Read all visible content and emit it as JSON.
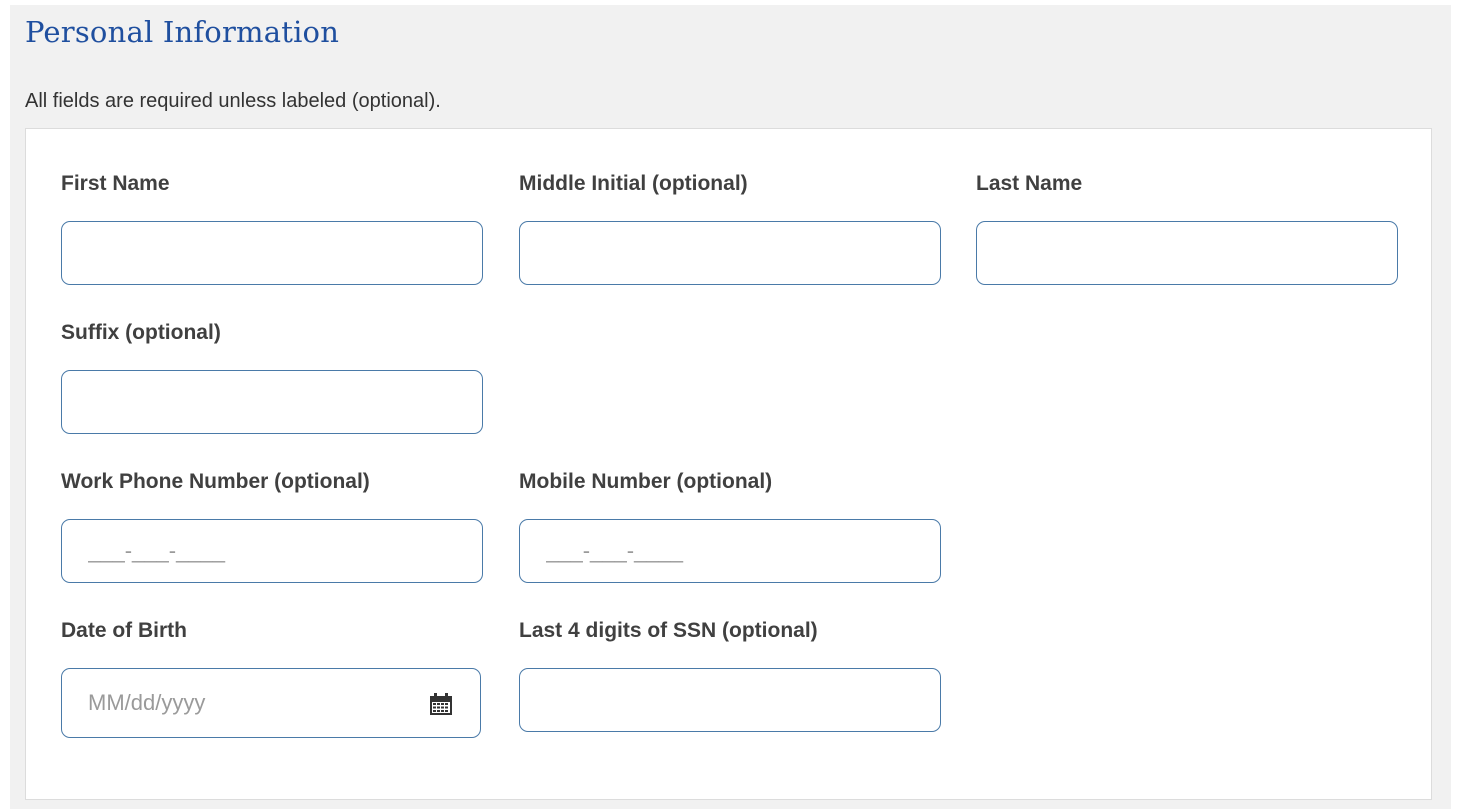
{
  "section": {
    "title": "Personal Information",
    "hint": "All fields are required unless labeled (optional)."
  },
  "fields": {
    "first_name": {
      "label": "First Name",
      "value": "",
      "placeholder": ""
    },
    "middle_initial": {
      "label": "Middle Initial (optional)",
      "value": "",
      "placeholder": ""
    },
    "last_name": {
      "label": "Last Name",
      "value": "",
      "placeholder": ""
    },
    "suffix": {
      "label": "Suffix (optional)",
      "value": "",
      "placeholder": ""
    },
    "work_phone": {
      "label": "Work Phone Number (optional)",
      "value": "",
      "placeholder": "___-___-____"
    },
    "mobile_number": {
      "label": "Mobile Number (optional)",
      "value": "",
      "placeholder": "___-___-____"
    },
    "date_of_birth": {
      "label": "Date of Birth",
      "value": "",
      "placeholder": "MM/dd/yyyy",
      "icon": "calendar-icon"
    },
    "ssn_last4": {
      "label": "Last 4 digits of SSN (optional)",
      "value": "",
      "placeholder": ""
    }
  },
  "colors": {
    "title": "#1f4f9f",
    "panel_background": "#f1f1f1",
    "input_border": "#4a7aa8",
    "label_text": "#404040"
  }
}
